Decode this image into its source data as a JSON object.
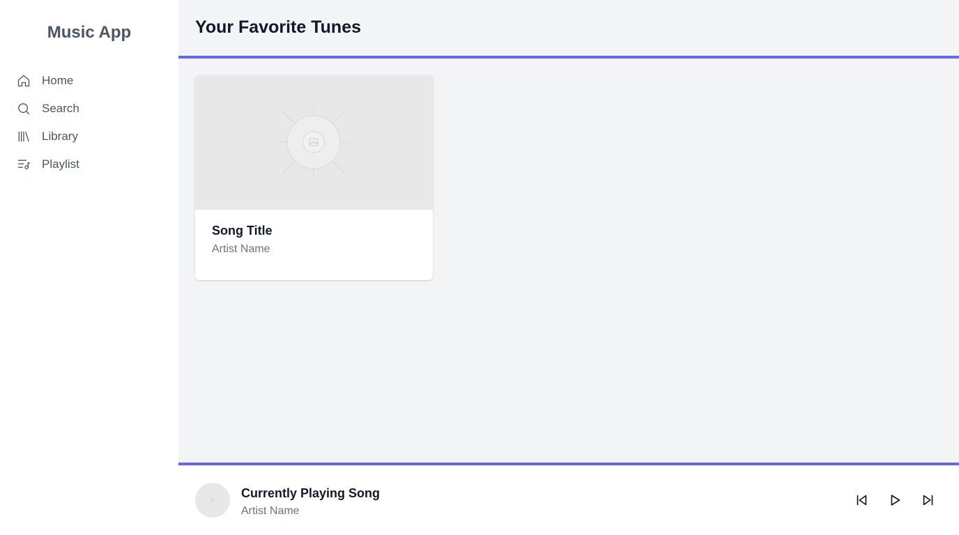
{
  "app": {
    "title": "Music App"
  },
  "sidebar": {
    "items": [
      {
        "label": "Home",
        "icon": "home-icon"
      },
      {
        "label": "Search",
        "icon": "search-icon"
      },
      {
        "label": "Library",
        "icon": "library-icon"
      },
      {
        "label": "Playlist",
        "icon": "playlist-icon"
      }
    ]
  },
  "header": {
    "title": "Your Favorite Tunes"
  },
  "cards": [
    {
      "song": "Song Title",
      "artist": "Artist Name",
      "image": "image-placeholder-icon"
    }
  ],
  "player": {
    "song": "Currently Playing Song",
    "artist": "Artist Name",
    "controls": [
      "previous-icon",
      "play-icon",
      "next-icon"
    ]
  },
  "colors": {
    "accent": "#6366f1",
    "sidebar_bg": "#ffffff",
    "main_bg": "#f3f4f6",
    "nav_text": "#4b5563",
    "muted_text": "#6b7280"
  }
}
